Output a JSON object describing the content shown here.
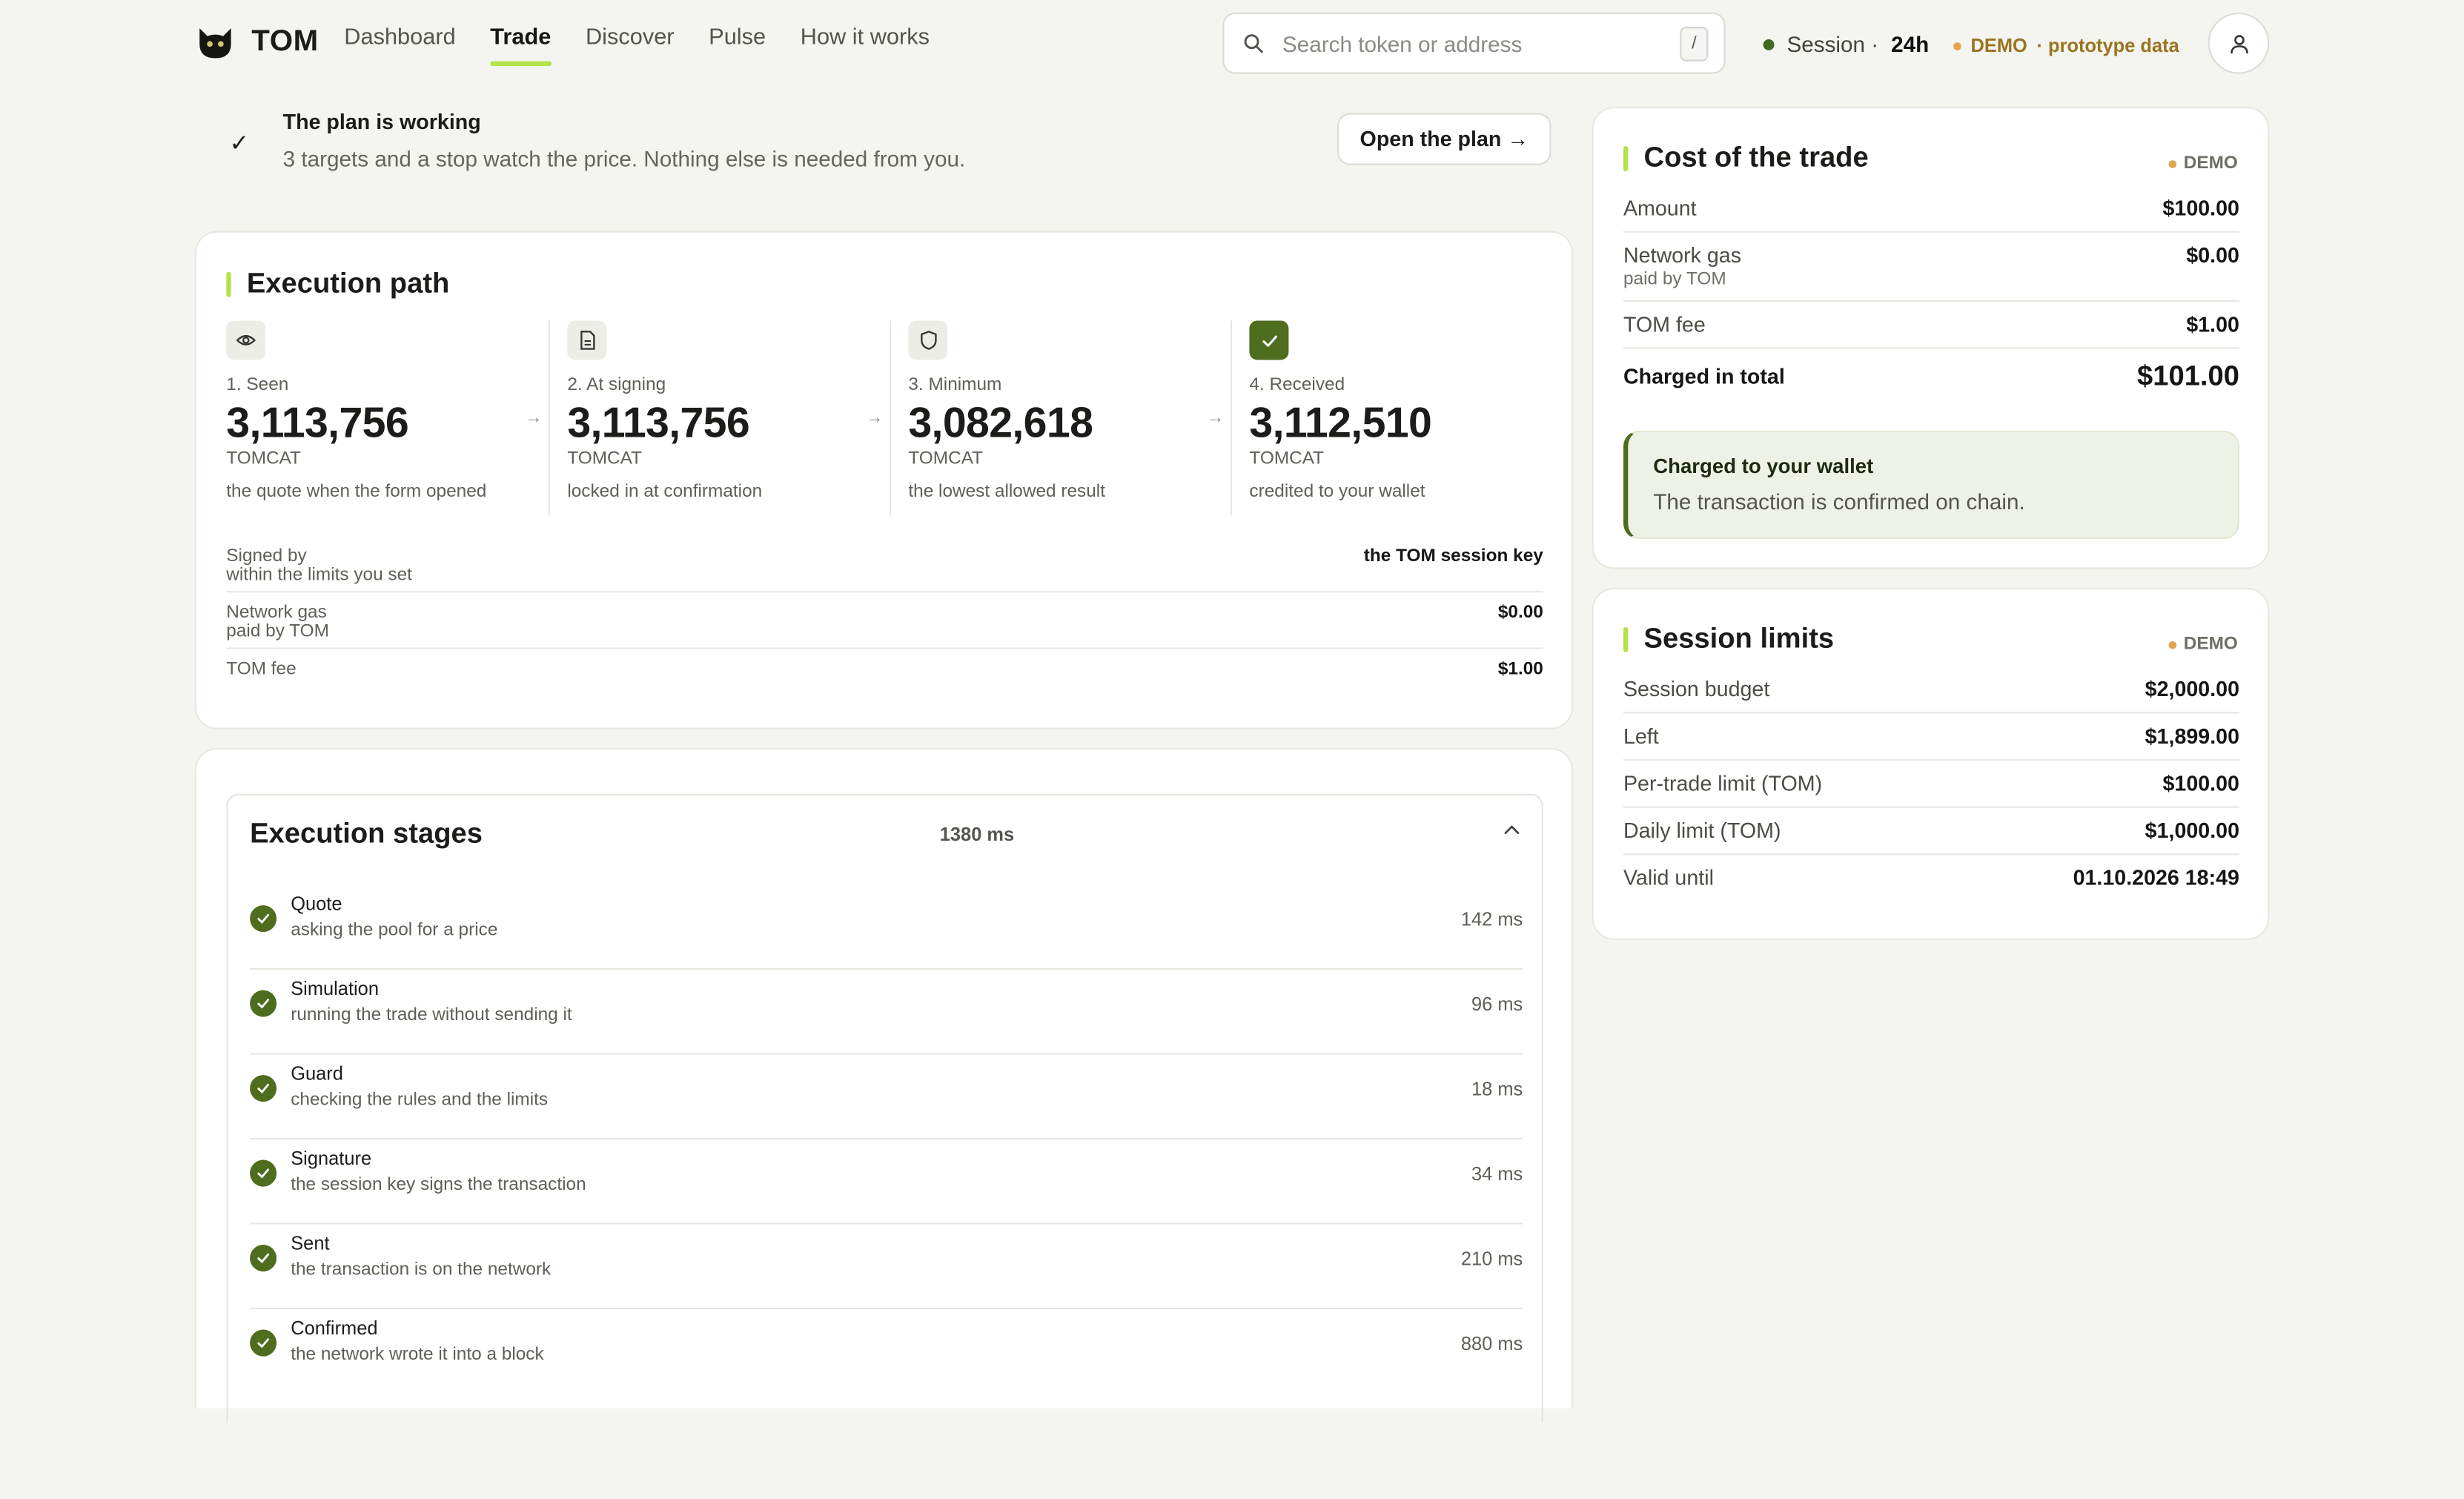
{
  "header": {
    "brand": "TOM",
    "nav": [
      "Dashboard",
      "Trade",
      "Discover",
      "Pulse",
      "How it works"
    ],
    "active_nav": "Trade",
    "search_placeholder": "Search token or address",
    "search_shortcut": "/",
    "session_label": "Session ·",
    "session_value": "24h",
    "demo_label": "DEMO",
    "demo_note": "· prototype data"
  },
  "banner": {
    "title": "The plan is working",
    "subtitle": "3 targets and a stop watch the price. Nothing else is needed from you.",
    "button": "Open the plan →"
  },
  "execution_path": {
    "title": "Execution path",
    "steps": [
      {
        "label": "1. Seen",
        "value": "3,113,756",
        "unit": "TOMCAT",
        "desc": "the quote when the form opened",
        "icon": "eye-icon"
      },
      {
        "label": "2. At signing",
        "value": "3,113,756",
        "unit": "TOMCAT",
        "desc": "locked in at confirmation",
        "icon": "document-icon"
      },
      {
        "label": "3. Minimum",
        "value": "3,082,618",
        "unit": "TOMCAT",
        "desc": "the lowest allowed result",
        "icon": "shield-icon"
      },
      {
        "label": "4. Received",
        "value": "3,112,510",
        "unit": "TOMCAT",
        "desc": "credited to your wallet",
        "icon": "check-icon"
      }
    ],
    "rows": [
      {
        "label": "Signed by",
        "sub": "within the limits you set",
        "value": "the TOM session key"
      },
      {
        "label": "Network gas",
        "sub": "paid by TOM",
        "value": "$0.00"
      },
      {
        "label": "TOM fee",
        "sub": "",
        "value": "$1.00"
      }
    ]
  },
  "execution_stages": {
    "title": "Execution stages",
    "total": "1380 ms",
    "stages": [
      {
        "name": "Quote",
        "desc": "asking the pool for a price",
        "ms": "142 ms"
      },
      {
        "name": "Simulation",
        "desc": "running the trade without sending it",
        "ms": "96 ms"
      },
      {
        "name": "Guard",
        "desc": "checking the rules and the limits",
        "ms": "18 ms"
      },
      {
        "name": "Signature",
        "desc": "the session key signs the transaction",
        "ms": "34 ms"
      },
      {
        "name": "Sent",
        "desc": "the transaction is on the network",
        "ms": "210 ms"
      },
      {
        "name": "Confirmed",
        "desc": "the network wrote it into a block",
        "ms": "880 ms"
      }
    ]
  },
  "cost": {
    "title": "Cost of the trade",
    "demo": "DEMO",
    "rows": [
      {
        "label": "Amount",
        "sub": "",
        "value": "$100.00"
      },
      {
        "label": "Network gas",
        "sub": "paid by TOM",
        "value": "$0.00"
      },
      {
        "label": "TOM fee",
        "sub": "",
        "value": "$1.00"
      }
    ],
    "total_label": "Charged in total",
    "total_value": "$101.00",
    "wallet_title": "Charged to your wallet",
    "wallet_sub": "The transaction is confirmed on chain."
  },
  "limits": {
    "title": "Session limits",
    "demo": "DEMO",
    "rows": [
      {
        "label": "Session budget",
        "value": "$2,000.00"
      },
      {
        "label": "Left",
        "value": "$1,899.00"
      },
      {
        "label": "Per-trade limit (TOM)",
        "value": "$100.00"
      },
      {
        "label": "Daily limit (TOM)",
        "value": "$1,000.00"
      },
      {
        "label": "Valid until",
        "value": "01.10.2026 18:49"
      }
    ]
  },
  "colors": {
    "accent": "#b6e14a",
    "success": "#4f6d1e",
    "session_dot": "#3f6a1f",
    "demo_dot": "#e0a54a"
  }
}
